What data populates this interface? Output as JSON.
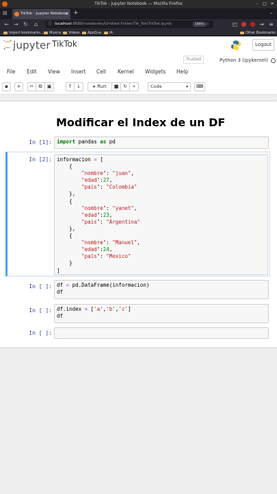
{
  "os": {
    "window_title": "TikTok - Jupyter Notebook — Mozilla Firefox"
  },
  "browser": {
    "tab_title": "TikTok - Jupyter Notebook",
    "url_host": "localhost",
    "url_path": ":8888/notebooks/Untitled Folder/Tik_Tok/TikTok.ipynb",
    "zoom": "148%",
    "bookmarks": [
      "Import bookmarks...",
      "Musica",
      "Videos",
      "AppQua",
      "IA"
    ],
    "other_bookmarks": "Other Bookmarks"
  },
  "jupyter": {
    "wordmark": "jupyter",
    "notebook_name": "TikTok",
    "logout_label": "Logout",
    "trusted_label": "Trusted",
    "kernel_name": "Python 3 (ipykernel)",
    "menu": [
      "File",
      "Edit",
      "View",
      "Insert",
      "Cell",
      "Kernel",
      "Widgets",
      "Help"
    ],
    "toolbar": {
      "run_label": "Run",
      "cell_type": "Code"
    }
  },
  "notebook": {
    "heading": "Modificar el Index de un DF",
    "cells": [
      {
        "prompt": "In [1]:",
        "lines": [
          "import pandas as pd"
        ]
      },
      {
        "prompt": "In [2]:",
        "lines": [
          "informacion = [",
          "    {",
          "        \"nombre\": \"juan\",",
          "        \"edad\":27,",
          "        \"pais\": \"Colombia\"",
          "    },",
          "    {",
          "        \"nombre\": \"yanet\",",
          "        \"edad\":23,",
          "        \"pais\": \"Argentina\"",
          "    },",
          "    {",
          "        \"nombre\": \"Manuel\",",
          "        \"edad\":24,",
          "        \"pais\": \"Mexico\"",
          "    }",
          "]"
        ]
      },
      {
        "prompt": "In [ ]:",
        "lines": [
          "df = pd.DataFrame(informacion)",
          "df"
        ]
      },
      {
        "prompt": "In [ ]:",
        "lines": [
          "df.index = ['a','b','c']",
          "df"
        ]
      },
      {
        "prompt": "In [ ]:",
        "lines": [
          ""
        ]
      }
    ]
  }
}
